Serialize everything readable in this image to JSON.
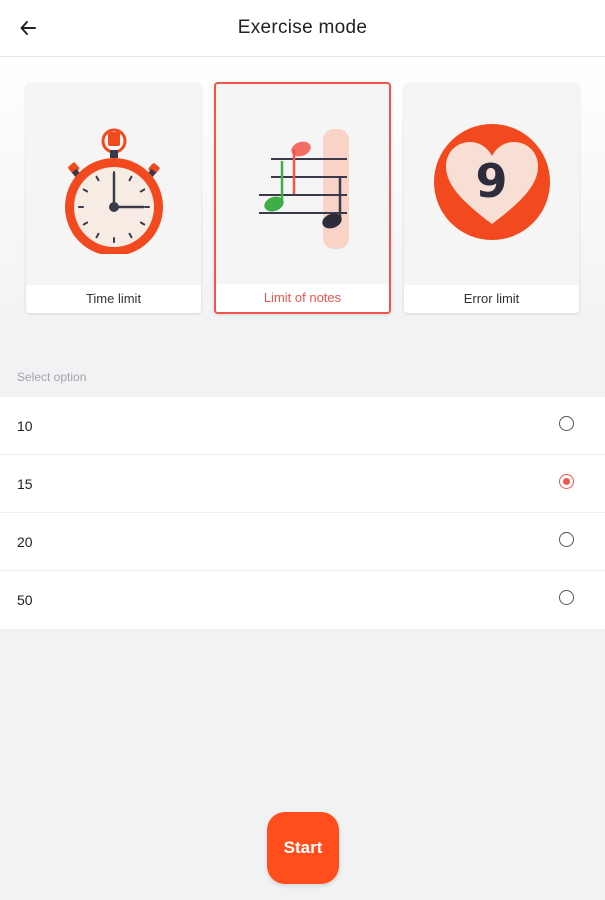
{
  "header": {
    "title": "Exercise mode",
    "back_icon": "arrow-left-icon"
  },
  "modes": [
    {
      "label": "Time limit",
      "icon": "stopwatch-icon",
      "selected": false
    },
    {
      "label": "Limit of notes",
      "icon": "music-notes-icon",
      "selected": true
    },
    {
      "label": "Error limit",
      "icon": "heart-counter-icon",
      "badge": "9",
      "selected": false
    }
  ],
  "section_label": "Select option",
  "options": [
    {
      "value": "10",
      "selected": false
    },
    {
      "value": "15",
      "selected": true
    },
    {
      "value": "20",
      "selected": false
    },
    {
      "value": "50",
      "selected": false
    }
  ],
  "start_label": "Start",
  "colors": {
    "accent": "#ff4d1c",
    "selected_border": "#f2554a",
    "background": "#f1f2f4"
  }
}
